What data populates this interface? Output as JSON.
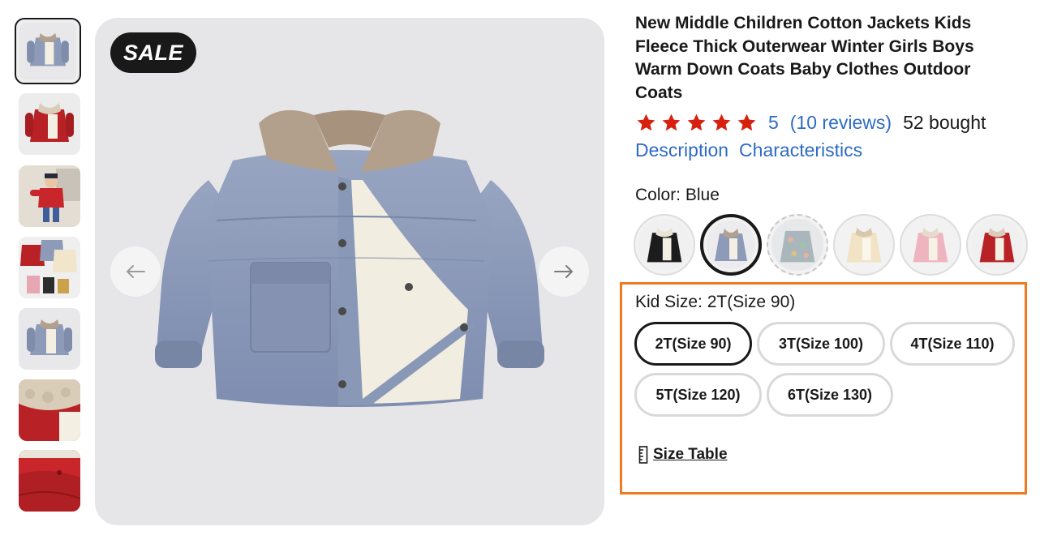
{
  "gallery": {
    "sale_label": "SALE",
    "thumbnails": [
      "blue-coat",
      "red-coat",
      "child-red-coat",
      "coat-set",
      "blue-coat-alt",
      "collar-detail",
      "red-fabric-detail"
    ]
  },
  "product": {
    "title": "New Middle Children Cotton Jackets Kids Fleece Thick Outerwear Winter Girls Boys Warm Down Coats Baby Clothes Outdoor Coats",
    "rating_value": "5",
    "rating_stars": 5,
    "reviews": "(10 reviews)",
    "bought": "52 bought",
    "links": {
      "description": "Description",
      "characteristics": "Characteristics"
    }
  },
  "color": {
    "label": "Color: Blue",
    "options": [
      "Black",
      "Blue",
      "Floral",
      "Cream",
      "Pink",
      "Red"
    ],
    "selected": "Blue"
  },
  "size": {
    "label": "Kid Size: 2T(Size 90)",
    "options": [
      "2T(Size 90)",
      "3T(Size 100)",
      "4T(Size 110)",
      "5T(Size 120)",
      "6T(Size 130)"
    ],
    "selected": "2T(Size 90)",
    "table_label": "Size Table"
  },
  "colors": {
    "star": "#d8200f",
    "link": "#2e6bc6",
    "highlight_border": "#f07a1c",
    "coat_blue": "#8d9bb8",
    "coat_red": "#b82226"
  }
}
